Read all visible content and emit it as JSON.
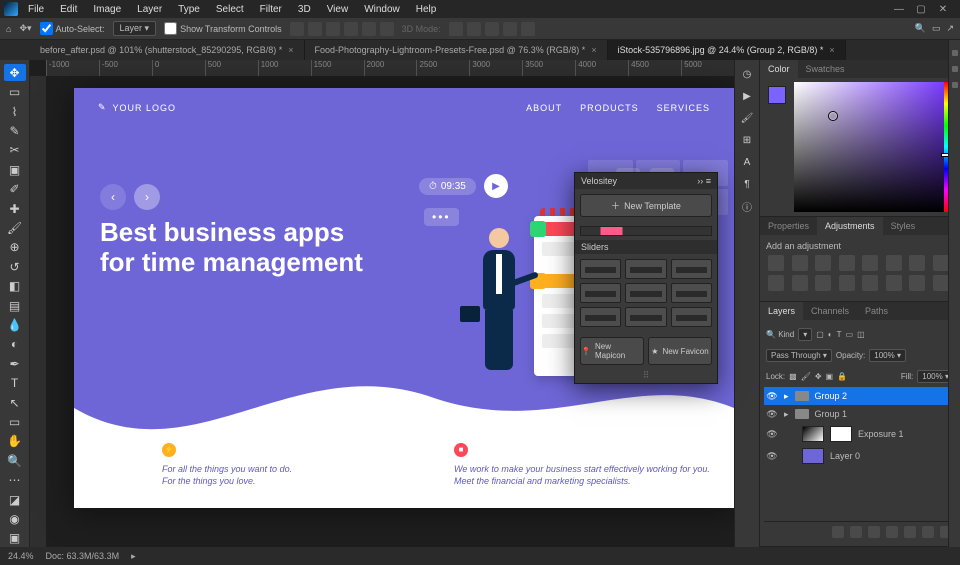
{
  "menubar": [
    "File",
    "Edit",
    "Image",
    "Layer",
    "Type",
    "Select",
    "Filter",
    "3D",
    "View",
    "Window",
    "Help"
  ],
  "optionsbar": {
    "auto_select": "Auto-Select:",
    "auto_target": "Layer",
    "show_transform": "Show Transform Controls",
    "threeD": "3D Mode:"
  },
  "tabs": [
    {
      "label": "before_after.psd @ 101% (shutterstock_85290295, RGB/8) *",
      "active": false
    },
    {
      "label": "Food-Photography-Lightroom-Presets-Free.psd @ 76.3% (RGB/8) *",
      "active": false
    },
    {
      "label": "iStock-535796896.jpg @ 24.4% (Group 2, RGB/8) *",
      "active": true
    }
  ],
  "ruler_marks": [
    "-1000",
    "-500",
    "0",
    "500",
    "1000",
    "1500",
    "2000",
    "2500",
    "3000",
    "3500",
    "4000",
    "4500",
    "5000"
  ],
  "artwork": {
    "logo_text": "YOUR LOGO",
    "nav": [
      "ABOUT",
      "PRODUCTS",
      "SERVICES"
    ],
    "clock": "09:35",
    "headline_l1": "Best business apps",
    "headline_l2": "for time management",
    "col_a_l1": "For all the things you want to do.",
    "col_a_l2": "For the things you love.",
    "col_b_l1": "We work to make your business start effectively working for you.",
    "col_b_l2": "Meet the financial and marketing specialists."
  },
  "velositey": {
    "title": "Velositey",
    "new_template": "New Template",
    "sliders": "Sliders",
    "new_mapicon": "New Mapicon",
    "new_favicon": "New Favicon"
  },
  "right": {
    "color_tab": "Color",
    "swatches_tab": "Swatches",
    "properties_tab": "Properties",
    "adjustments_tab": "Adjustments",
    "styles_tab": "Styles",
    "add_adjustment": "Add an adjustment",
    "layers_tab": "Layers",
    "channels_tab": "Channels",
    "paths_tab": "Paths",
    "kind": "Kind",
    "blend": "Pass Through",
    "opacity_lbl": "Opacity:",
    "opacity_val": "100%",
    "lock_lbl": "Lock:",
    "fill_lbl": "Fill:",
    "fill_val": "100%",
    "layers": [
      {
        "name": "Group 2",
        "type": "folder",
        "active": true
      },
      {
        "name": "Group 1",
        "type": "folder",
        "active": false
      },
      {
        "name": "Exposure 1",
        "type": "adj",
        "active": false
      },
      {
        "name": "Layer 0",
        "type": "bitmap",
        "active": false
      }
    ]
  },
  "status": {
    "zoom": "24.4%",
    "doc": "Doc: 63.3M/63.3M"
  }
}
